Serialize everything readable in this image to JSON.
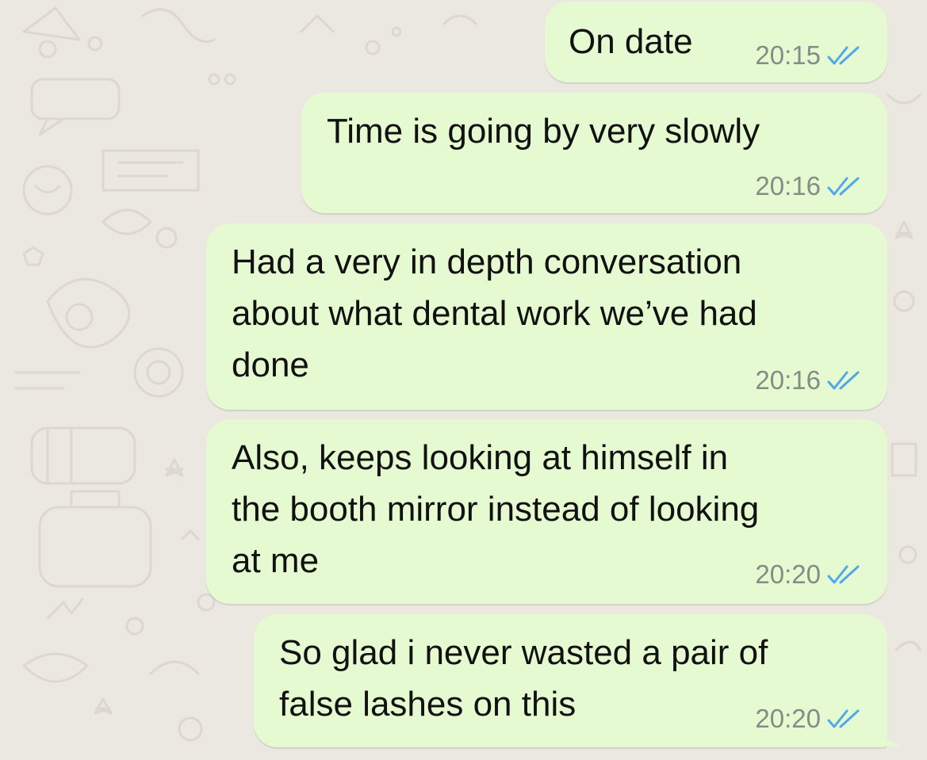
{
  "chat": {
    "messages": [
      {
        "text": "On date",
        "time": "20:15",
        "status_icon": "double-check-read-icon"
      },
      {
        "text": "Time is going by very slowly",
        "time": "20:16",
        "status_icon": "double-check-read-icon"
      },
      {
        "text": "Had a very in depth conversation\nabout what dental work we’ve had\ndone",
        "time": "20:16",
        "status_icon": "double-check-read-icon"
      },
      {
        "text": "Also, keeps looking at himself in\nthe booth mirror instead of looking\nat me",
        "time": "20:20",
        "status_icon": "double-check-read-icon"
      },
      {
        "text": "So glad i never wasted a pair of\nfalse lashes on this",
        "time": "20:20",
        "status_icon": "double-check-read-icon"
      }
    ]
  },
  "colors": {
    "outgoing_bubble": "#e6fad2",
    "wallpaper": "#ebe7e1",
    "read_tick": "#4fa8e8",
    "timestamp": "#858b85"
  }
}
